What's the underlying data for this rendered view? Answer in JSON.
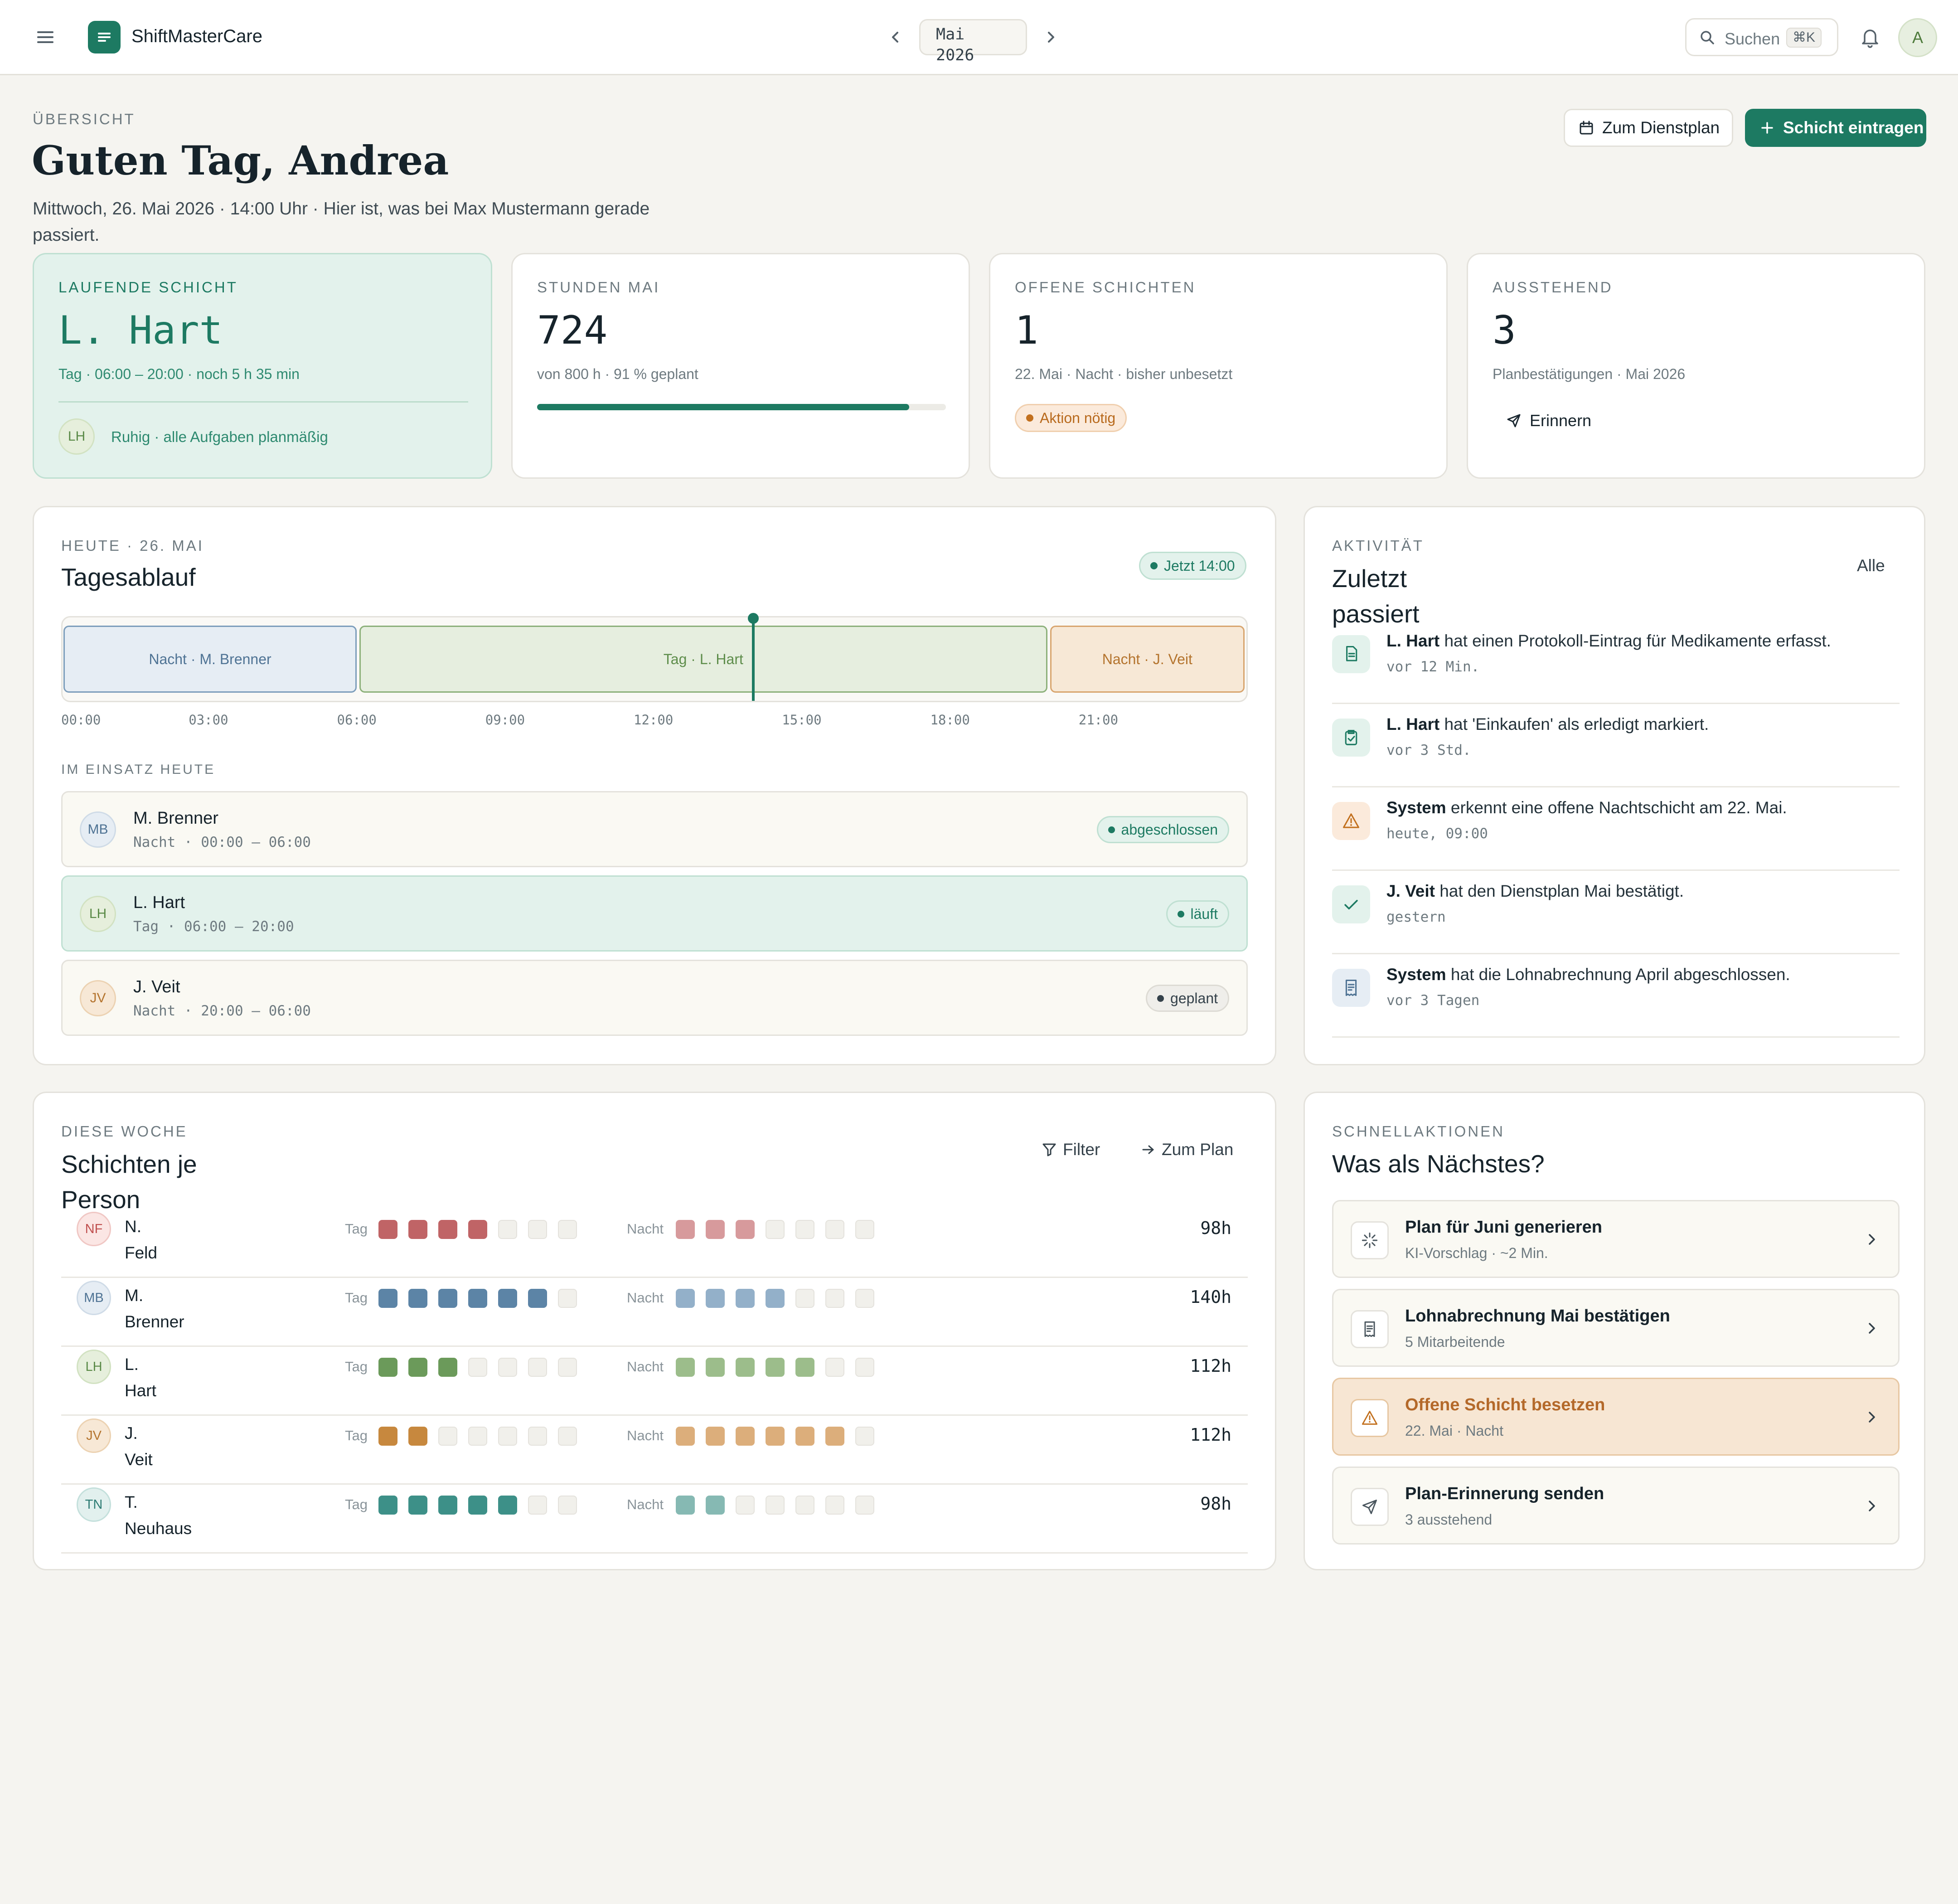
{
  "app": {
    "name": "ShiftMasterCare"
  },
  "header": {
    "month": "Mai 2026",
    "search_label": "Suchen",
    "search_shortcut": "⌘K",
    "avatar_initial": "A"
  },
  "page": {
    "eyebrow": "ÜBERSICHT",
    "title": "Guten Tag, Andrea",
    "subtitle_line1": "Mittwoch, 26. Mai 2026 · 14:00 Uhr · Hier ist, was bei Max Mustermann gerade",
    "subtitle_line2": "passiert.",
    "btn_plan": "Zum Dienstplan",
    "btn_add": "Schicht eintragen"
  },
  "stats": {
    "current": {
      "label": "LAUFENDE SCHICHT",
      "name": "L. Hart",
      "detail": "Tag · 06:00 – 20:00 · noch 5 h 35 min",
      "avatar": "LH",
      "note": "Ruhig · alle Aufgaben planmäßig"
    },
    "hours": {
      "label": "STUNDEN MAI",
      "value": "724",
      "detail": "von 800 h · 91 % geplant",
      "progress": 0.91
    },
    "open": {
      "label": "OFFENE SCHICHTEN",
      "value": "1",
      "detail": "22. Mai · Nacht · bisher unbesetzt",
      "badge": "Aktion nötig"
    },
    "pending": {
      "label": "AUSSTEHEND",
      "value": "3",
      "detail": "Planbestätigungen · Mai 2026",
      "action": "Erinnern"
    }
  },
  "timeline": {
    "eyebrow": "HEUTE · 26. MAI",
    "title": "Tagesablauf",
    "now_badge": "Jetzt 14:00",
    "now_hour": 14,
    "segments": [
      {
        "label": "Nacht · M. Brenner",
        "start": 0,
        "end": 6,
        "kind": "blue"
      },
      {
        "label": "Tag · L. Hart",
        "start": 6,
        "end": 20,
        "kind": "green"
      },
      {
        "label": "Nacht · J. Veit",
        "start": 20,
        "end": 24,
        "kind": "orange"
      }
    ],
    "ticks": [
      "00:00",
      "03:00",
      "06:00",
      "09:00",
      "12:00",
      "15:00",
      "18:00",
      "21:00"
    ],
    "section_label": "IM EINSATZ HEUTE",
    "people": [
      {
        "initials": "MB",
        "name": "M. Brenner",
        "shift": "Nacht · 00:00 – 06:00",
        "status": "abgeschlossen"
      },
      {
        "initials": "LH",
        "name": "L. Hart",
        "shift": "Tag · 06:00 – 20:00",
        "status": "läuft"
      },
      {
        "initials": "JV",
        "name": "J. Veit",
        "shift": "Nacht · 20:00 – 06:00",
        "status": "geplant"
      }
    ]
  },
  "activity": {
    "eyebrow": "AKTIVITÄT",
    "title_line1": "Zuletzt",
    "title_line2": "passiert",
    "all_label": "Alle",
    "items": [
      {
        "actor": "L. Hart",
        "text": " hat einen Protokoll-Eintrag für Medikamente erfasst.",
        "time": "vor 12 Min.",
        "icon": "document-icon"
      },
      {
        "actor": "L. Hart",
        "text": " hat 'Einkaufen' als erledigt markiert.",
        "time": "vor 3 Std.",
        "icon": "clipboard-check-icon"
      },
      {
        "actor": "System",
        "text": " erkennt eine offene Nachtschicht am 22. Mai.",
        "time": "heute, 09:00",
        "icon": "warning-icon"
      },
      {
        "actor": "J. Veit",
        "text": " hat den Dienstplan Mai bestätigt.",
        "time": "gestern",
        "icon": "check-icon"
      },
      {
        "actor": "System",
        "text": " hat die Lohnabrechnung April abgeschlossen.",
        "time": "vor 3 Tagen",
        "icon": "receipt-icon"
      }
    ]
  },
  "week": {
    "eyebrow": "DIESE WOCHE",
    "title_line1": "Schichten je",
    "title_line2": "Person",
    "filter_label": "Filter",
    "plan_label": "Zum Plan",
    "day_label": "Tag",
    "night_label": "Nacht",
    "people": [
      {
        "initials": "NF",
        "first": "N.",
        "last": "Feld",
        "day": 4,
        "night": 3,
        "hours": "98h"
      },
      {
        "initials": "MB",
        "first": "M.",
        "last": "Brenner",
        "day": 6,
        "night": 4,
        "hours": "140h"
      },
      {
        "initials": "LH",
        "first": "L.",
        "last": "Hart",
        "day": 3,
        "night": 5,
        "hours": "112h"
      },
      {
        "initials": "JV",
        "first": "J.",
        "last": "Veit",
        "day": 2,
        "night": 6,
        "hours": "112h"
      },
      {
        "initials": "TN",
        "first": "T.",
        "last": "Neuhaus",
        "day": 5,
        "night": 2,
        "hours": "98h"
      }
    ]
  },
  "quick": {
    "eyebrow": "SCHNELLAKTIONEN",
    "title": "Was als Nächstes?",
    "actions": [
      {
        "title": "Plan für Juni generieren",
        "sub": "KI-Vorschlag · ~2 Min.",
        "icon": "sparkle-icon",
        "highlight": false
      },
      {
        "title": "Lohnabrechnung Mai bestätigen",
        "sub": "5 Mitarbeitende",
        "icon": "receipt-icon",
        "highlight": false
      },
      {
        "title": "Offene Schicht besetzen",
        "sub": "22. Mai · Nacht",
        "icon": "warning-icon",
        "highlight": true
      },
      {
        "title": "Plan-Erinnerung senden",
        "sub": "3 ausstehend",
        "icon": "send-icon",
        "highlight": false
      }
    ]
  },
  "colors": {
    "accent": "#1d7a62",
    "warning": "#b86a1d",
    "blue": "#5c84a6",
    "red": "#c06466",
    "green": "#6b9a5a",
    "orange": "#c7883e",
    "teal": "#3d9088"
  }
}
